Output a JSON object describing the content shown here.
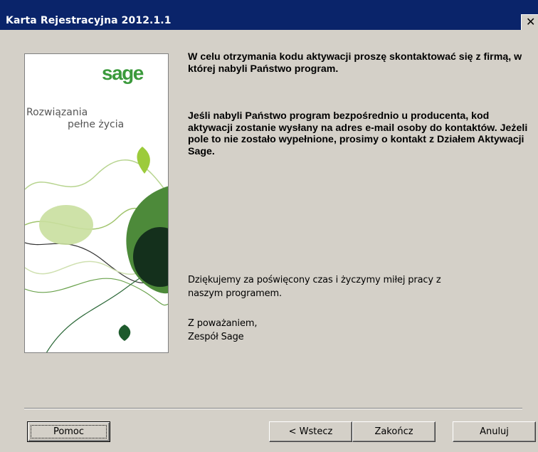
{
  "window": {
    "title": "Karta Rejestracyjna 2012.1.1",
    "close_symbol": "✕",
    "close_icon": "close-icon"
  },
  "sidebar": {
    "logo": "sage",
    "tagline_line1": "Rozwiązania",
    "tagline_line2": "pełne życia",
    "brand_color": "#3b9a3c"
  },
  "content": {
    "paragraph1": "W celu otrzymania kodu aktywacji proszę skontaktować się z firmą, w której nabyli Państwo program.",
    "paragraph2": "Jeśli nabyli Państwo program bezpośrednio u producenta, kod aktywacji zostanie wysłany na adres e-mail osoby do kontaktów. Jeżeli pole to nie zostało wypełnione, prosimy o kontakt z Działem Aktywacji Sage.",
    "thanks_line1": "Dziękujemy za poświęcony czas i życzymy miłej pracy z",
    "thanks_line2": "naszym programem.",
    "regards_line1": "Z poważaniem,",
    "regards_line2": "Zespół Sage"
  },
  "buttons": {
    "help": "Pomoc",
    "back": "< Wstecz",
    "finish": "Zakończ",
    "cancel": "Anuluj"
  },
  "colors": {
    "titlebar": "#0a246a",
    "dialog_bg": "#d4d0c8",
    "accent_green": "#3b9a3c",
    "dark_green": "#1e5b2d"
  }
}
